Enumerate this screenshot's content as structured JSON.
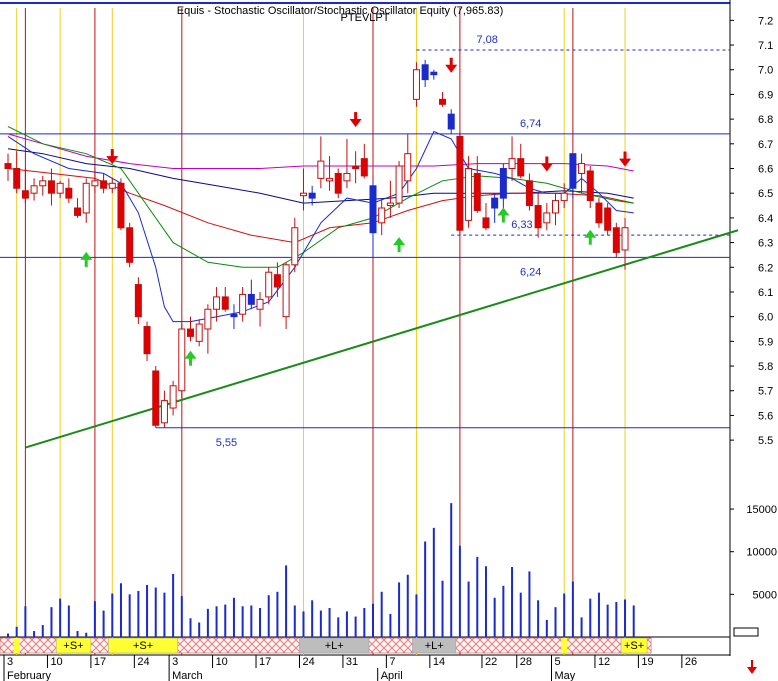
{
  "header": {
    "title": "Equis - Stochastic Oscillator/Stochastic Oscillator Equity (7,965.83)",
    "subtitle": "PTEVLPT"
  },
  "chart_data": {
    "type": "candlestick",
    "price_axis": {
      "ylim": [
        5.46,
        7.25
      ],
      "ticks": [
        7.2,
        7.1,
        7.0,
        6.9,
        6.8,
        6.7,
        6.6,
        6.5,
        6.4,
        6.3,
        6.2,
        6.1,
        6.0,
        5.9,
        5.8,
        5.7,
        5.6,
        5.5
      ],
      "tick_labels": [
        "7.2",
        "7.1",
        "7.0",
        "6.9",
        "6.8",
        "6.7",
        "6.6",
        "6.5",
        "6.4",
        "6.3",
        "6.2",
        "6.1",
        "6.0",
        "5.9",
        "5.8",
        "5.7",
        "5.6",
        "5.5"
      ]
    },
    "volume_axis": {
      "ylim": [
        0,
        17000
      ],
      "ticks": [
        5000,
        10000,
        15000
      ],
      "tick_labels": [
        "5000",
        "10000",
        "15000"
      ]
    },
    "x_axis": {
      "day_labels": [
        "3",
        "10",
        "17",
        "24",
        "3",
        "10",
        "17",
        "24",
        "31",
        "7",
        "14",
        "22",
        "28",
        "5",
        "12",
        "19",
        "26"
      ],
      "day_index": [
        0,
        5,
        10,
        15,
        19,
        24,
        29,
        34,
        39,
        44,
        49,
        55,
        59,
        63,
        68,
        73,
        78
      ],
      "months": [
        {
          "label": "February",
          "index": 0
        },
        {
          "label": "March",
          "index": 19
        },
        {
          "label": "April",
          "index": 43
        },
        {
          "label": "May",
          "index": 63
        }
      ],
      "n_slots": 84
    },
    "candles": [
      {
        "o": 6.62,
        "h": 6.66,
        "l": 6.55,
        "c": 6.6
      },
      {
        "o": 6.6,
        "h": 6.67,
        "l": 6.5,
        "c": 6.52
      },
      {
        "o": 6.51,
        "h": 6.6,
        "l": 6.46,
        "c": 6.48
      },
      {
        "o": 6.5,
        "h": 6.56,
        "l": 6.47,
        "c": 6.53
      },
      {
        "o": 6.53,
        "h": 6.57,
        "l": 6.49,
        "c": 6.55
      },
      {
        "o": 6.55,
        "h": 6.6,
        "l": 6.45,
        "c": 6.5
      },
      {
        "o": 6.5,
        "h": 6.55,
        "l": 6.48,
        "c": 6.54
      },
      {
        "o": 6.52,
        "h": 6.56,
        "l": 6.46,
        "c": 6.48
      },
      {
        "o": 6.44,
        "h": 6.48,
        "l": 6.4,
        "c": 6.41
      },
      {
        "o": 6.42,
        "h": 6.56,
        "l": 6.38,
        "c": 6.54
      },
      {
        "o": 6.53,
        "h": 6.6,
        "l": 6.5,
        "c": 6.55
      },
      {
        "o": 6.55,
        "h": 6.58,
        "l": 6.5,
        "c": 6.52
      },
      {
        "o": 6.52,
        "h": 6.56,
        "l": 6.5,
        "c": 6.54
      },
      {
        "o": 6.54,
        "h": 6.56,
        "l": 6.35,
        "c": 6.36
      },
      {
        "o": 6.36,
        "h": 6.38,
        "l": 6.2,
        "c": 6.22
      },
      {
        "o": 6.13,
        "h": 6.16,
        "l": 5.97,
        "c": 6.0
      },
      {
        "o": 5.96,
        "h": 5.98,
        "l": 5.82,
        "c": 5.85
      },
      {
        "o": 5.78,
        "h": 5.8,
        "l": 5.55,
        "c": 5.56
      },
      {
        "o": 5.57,
        "h": 5.7,
        "l": 5.55,
        "c": 5.66
      },
      {
        "o": 5.63,
        "h": 5.74,
        "l": 5.6,
        "c": 5.72
      },
      {
        "o": 5.7,
        "h": 5.97,
        "l": 5.67,
        "c": 5.95
      },
      {
        "o": 5.95,
        "h": 6.0,
        "l": 5.9,
        "c": 5.92
      },
      {
        "o": 5.9,
        "h": 5.99,
        "l": 5.88,
        "c": 5.97
      },
      {
        "o": 5.95,
        "h": 6.05,
        "l": 5.85,
        "c": 6.03
      },
      {
        "o": 6.03,
        "h": 6.12,
        "l": 5.98,
        "c": 6.08
      },
      {
        "o": 6.08,
        "h": 6.12,
        "l": 6.02,
        "c": 6.03
      },
      {
        "o": 6.0,
        "h": 6.05,
        "l": 5.95,
        "c": 6.01
      },
      {
        "o": 6.01,
        "h": 6.12,
        "l": 5.98,
        "c": 6.09
      },
      {
        "o": 6.09,
        "h": 6.15,
        "l": 6.03,
        "c": 6.05
      },
      {
        "o": 6.03,
        "h": 6.1,
        "l": 5.96,
        "c": 6.07
      },
      {
        "o": 6.08,
        "h": 6.2,
        "l": 6.05,
        "c": 6.18
      },
      {
        "o": 6.17,
        "h": 6.22,
        "l": 6.08,
        "c": 6.12
      },
      {
        "o": 6.0,
        "h": 6.22,
        "l": 5.95,
        "c": 6.21
      },
      {
        "o": 6.21,
        "h": 6.4,
        "l": 6.18,
        "c": 6.36
      },
      {
        "o": 6.49,
        "h": 6.6,
        "l": 6.43,
        "c": 6.5
      },
      {
        "o": 6.5,
        "h": 6.53,
        "l": 6.45,
        "c": 6.48
      },
      {
        "o": 6.56,
        "h": 6.73,
        "l": 6.52,
        "c": 6.63
      },
      {
        "o": 6.55,
        "h": 6.65,
        "l": 6.51,
        "c": 6.56
      },
      {
        "o": 6.58,
        "h": 6.6,
        "l": 6.48,
        "c": 6.5
      },
      {
        "o": 6.55,
        "h": 6.72,
        "l": 6.52,
        "c": 6.58
      },
      {
        "o": 6.61,
        "h": 6.67,
        "l": 6.54,
        "c": 6.6
      },
      {
        "o": 6.64,
        "h": 6.7,
        "l": 6.56,
        "c": 6.57
      },
      {
        "o": 6.53,
        "h": 6.55,
        "l": 6.24,
        "c": 6.34
      },
      {
        "o": 6.38,
        "h": 6.48,
        "l": 6.33,
        "c": 6.44
      },
      {
        "o": 6.45,
        "h": 6.55,
        "l": 6.4,
        "c": 6.46
      },
      {
        "o": 6.46,
        "h": 6.63,
        "l": 6.44,
        "c": 6.61
      },
      {
        "o": 6.55,
        "h": 6.74,
        "l": 6.5,
        "c": 6.66
      },
      {
        "o": 6.88,
        "h": 7.03,
        "l": 6.85,
        "c": 7.0
      },
      {
        "o": 6.96,
        "h": 7.04,
        "l": 6.93,
        "c": 7.02
      },
      {
        "o": 6.99,
        "h": 7.0,
        "l": 6.96,
        "c": 6.98
      },
      {
        "o": 6.88,
        "h": 6.91,
        "l": 6.85,
        "c": 6.86
      },
      {
        "o": 6.82,
        "h": 6.84,
        "l": 6.74,
        "c": 6.76
      },
      {
        "o": 6.73,
        "h": 6.75,
        "l": 6.33,
        "c": 6.35
      },
      {
        "o": 6.39,
        "h": 6.65,
        "l": 6.36,
        "c": 6.6
      },
      {
        "o": 6.58,
        "h": 6.65,
        "l": 6.42,
        "c": 6.43
      },
      {
        "o": 6.4,
        "h": 6.46,
        "l": 6.35,
        "c": 6.36
      },
      {
        "o": 6.44,
        "h": 6.5,
        "l": 6.38,
        "c": 6.48
      },
      {
        "o": 6.48,
        "h": 6.62,
        "l": 6.44,
        "c": 6.6
      },
      {
        "o": 6.6,
        "h": 6.73,
        "l": 6.55,
        "c": 6.64
      },
      {
        "o": 6.64,
        "h": 6.7,
        "l": 6.56,
        "c": 6.57
      },
      {
        "o": 6.55,
        "h": 6.58,
        "l": 6.43,
        "c": 6.45
      },
      {
        "o": 6.45,
        "h": 6.5,
        "l": 6.32,
        "c": 6.36
      },
      {
        "o": 6.38,
        "h": 6.46,
        "l": 6.35,
        "c": 6.42
      },
      {
        "o": 6.42,
        "h": 6.5,
        "l": 6.37,
        "c": 6.47
      },
      {
        "o": 6.47,
        "h": 6.54,
        "l": 6.44,
        "c": 6.5
      },
      {
        "o": 6.52,
        "h": 6.66,
        "l": 6.48,
        "c": 6.66
      },
      {
        "o": 6.58,
        "h": 6.66,
        "l": 6.5,
        "c": 6.62
      },
      {
        "o": 6.59,
        "h": 6.61,
        "l": 6.44,
        "c": 6.47
      },
      {
        "o": 6.46,
        "h": 6.48,
        "l": 6.36,
        "c": 6.38
      },
      {
        "o": 6.44,
        "h": 6.46,
        "l": 6.33,
        "c": 6.35
      },
      {
        "o": 6.36,
        "h": 6.38,
        "l": 6.24,
        "c": 6.26
      },
      {
        "o": 6.27,
        "h": 6.4,
        "l": 6.19,
        "c": 6.36
      }
    ],
    "blue_candles": [
      26,
      28,
      35,
      42,
      48,
      49,
      51,
      56,
      57,
      65
    ],
    "volume": [
      400,
      1200,
      3600,
      700,
      1400,
      3500,
      4500,
      3700,
      700,
      500,
      4200,
      3100,
      5100,
      6300,
      5000,
      5400,
      6100,
      5800,
      5200,
      7400,
      4800,
      2200,
      1700,
      3300,
      3600,
      3800,
      4600,
      3600,
      3700,
      3400,
      4900,
      5300,
      8400,
      3700,
      3000,
      4300,
      3100,
      3400,
      2300,
      3000,
      2400,
      3400,
      3900,
      5300,
      2700,
      6400,
      7300,
      5000,
      11200,
      12800,
      6600,
      15700,
      10700,
      6500,
      9400,
      8300,
      4600,
      6000,
      8200,
      5200,
      7700,
      4300,
      2000,
      3500,
      5100,
      6500,
      2300,
      4500,
      5200,
      3800,
      4100,
      4400,
      3700
    ],
    "horizontal_levels": [
      {
        "value": 7.08,
        "label": "7,08",
        "style": "dashed",
        "start": 47
      },
      {
        "value": 6.74,
        "label": "6,74",
        "style": "solid",
        "start": 0
      },
      {
        "value": 6.33,
        "label": "6,33",
        "style": "dashed",
        "start": 51
      },
      {
        "value": 6.24,
        "label": "6,24",
        "style": "solid",
        "start": 0
      },
      {
        "value": 5.55,
        "label": "5,55",
        "style": "solid",
        "start": 17
      }
    ],
    "trendline": {
      "x1": 2,
      "y1": 5.47,
      "x2": 84,
      "y2": 6.35
    },
    "ma_series": [
      {
        "color": "#c000c0",
        "points": [
          [
            0,
            6.74
          ],
          [
            4,
            6.7
          ],
          [
            9,
            6.65
          ],
          [
            14,
            6.62
          ],
          [
            19,
            6.6
          ],
          [
            24,
            6.6
          ],
          [
            29,
            6.6
          ],
          [
            34,
            6.61
          ],
          [
            39,
            6.61
          ],
          [
            44,
            6.61
          ],
          [
            49,
            6.61
          ],
          [
            54,
            6.62
          ],
          [
            59,
            6.62
          ],
          [
            64,
            6.62
          ],
          [
            69,
            6.61
          ],
          [
            72,
            6.59
          ]
        ]
      },
      {
        "color": "#0a0a80",
        "points": [
          [
            0,
            6.68
          ],
          [
            4,
            6.66
          ],
          [
            9,
            6.62
          ],
          [
            14,
            6.6
          ],
          [
            19,
            6.56
          ],
          [
            24,
            6.53
          ],
          [
            29,
            6.5
          ],
          [
            34,
            6.46
          ],
          [
            39,
            6.47
          ],
          [
            44,
            6.48
          ],
          [
            49,
            6.5
          ],
          [
            54,
            6.5
          ],
          [
            59,
            6.5
          ],
          [
            64,
            6.51
          ],
          [
            69,
            6.5
          ],
          [
            72,
            6.48
          ]
        ]
      },
      {
        "color": "#d01010",
        "points": [
          [
            0,
            6.6
          ],
          [
            5,
            6.58
          ],
          [
            10,
            6.56
          ],
          [
            14,
            6.5
          ],
          [
            18,
            6.45
          ],
          [
            23,
            6.38
          ],
          [
            28,
            6.33
          ],
          [
            33,
            6.3
          ],
          [
            37,
            6.36
          ],
          [
            42,
            6.38
          ],
          [
            46,
            6.43
          ],
          [
            50,
            6.47
          ],
          [
            54,
            6.49
          ],
          [
            58,
            6.5
          ],
          [
            63,
            6.5
          ],
          [
            68,
            6.49
          ],
          [
            72,
            6.46
          ]
        ]
      },
      {
        "color": "#0a8a0a",
        "points": [
          [
            0,
            6.77
          ],
          [
            4,
            6.7
          ],
          [
            9,
            6.66
          ],
          [
            13,
            6.6
          ],
          [
            16,
            6.45
          ],
          [
            19,
            6.3
          ],
          [
            23,
            6.22
          ],
          [
            27,
            6.2
          ],
          [
            31,
            6.2
          ],
          [
            34,
            6.26
          ],
          [
            38,
            6.36
          ],
          [
            42,
            6.4
          ],
          [
            46,
            6.48
          ],
          [
            50,
            6.55
          ],
          [
            54,
            6.57
          ],
          [
            58,
            6.56
          ],
          [
            62,
            6.54
          ],
          [
            66,
            6.5
          ],
          [
            70,
            6.47
          ],
          [
            72,
            6.46
          ]
        ]
      },
      {
        "color": "#1a2acc",
        "points": [
          [
            0,
            6.73
          ],
          [
            3,
            6.66
          ],
          [
            7,
            6.6
          ],
          [
            11,
            6.58
          ],
          [
            13,
            6.54
          ],
          [
            15,
            6.42
          ],
          [
            17,
            6.2
          ],
          [
            18,
            6.04
          ],
          [
            19,
            5.98
          ],
          [
            21,
            5.98
          ],
          [
            24,
            6.0
          ],
          [
            27,
            6.02
          ],
          [
            30,
            6.06
          ],
          [
            33,
            6.2
          ],
          [
            36,
            6.38
          ],
          [
            39,
            6.48
          ],
          [
            42,
            6.46
          ],
          [
            45,
            6.5
          ],
          [
            47,
            6.6
          ],
          [
            49,
            6.75
          ],
          [
            51,
            6.72
          ],
          [
            53,
            6.6
          ],
          [
            56,
            6.58
          ],
          [
            58,
            6.56
          ],
          [
            60,
            6.52
          ],
          [
            62,
            6.5
          ],
          [
            64,
            6.5
          ],
          [
            66,
            6.56
          ],
          [
            68,
            6.5
          ],
          [
            70,
            6.43
          ],
          [
            72,
            6.42
          ]
        ]
      }
    ],
    "signals": [
      {
        "slot": 12,
        "dir": "down",
        "value": 6.63
      },
      {
        "slot": 9,
        "dir": "up",
        "value": 6.25
      },
      {
        "slot": 21,
        "dir": "up",
        "value": 5.85
      },
      {
        "slot": 40,
        "dir": "down",
        "value": 6.78
      },
      {
        "slot": 45,
        "dir": "up",
        "value": 6.31
      },
      {
        "slot": 51,
        "dir": "down",
        "value": 7.0
      },
      {
        "slot": 57,
        "dir": "up",
        "value": 6.43
      },
      {
        "slot": 62,
        "dir": "down",
        "value": 6.6
      },
      {
        "slot": 67,
        "dir": "up",
        "value": 6.34
      },
      {
        "slot": 71,
        "dir": "down",
        "value": 6.62
      }
    ],
    "vertical_lines": {
      "red": [
        2,
        10,
        20,
        42,
        52,
        65
      ],
      "yellow": [
        1,
        6,
        12,
        34,
        47,
        64,
        71
      ]
    },
    "signal_bar": {
      "labels": [
        {
          "text": "+S+",
          "start": 6,
          "end": 10,
          "color": "#ffff33"
        },
        {
          "text": "+S+",
          "start": 12,
          "end": 20,
          "color": "#ffff33"
        },
        {
          "text": "+L+",
          "start": 34,
          "end": 42,
          "color": "#bdbdbd"
        },
        {
          "text": "+L+",
          "start": 47,
          "end": 52,
          "color": "#bdbdbd"
        },
        {
          "text": "+S+",
          "start": 71,
          "end": 74,
          "color": "#ffff33"
        }
      ],
      "yellow_marks": [
        1,
        64
      ]
    }
  },
  "footer": {
    "arrow": "down-arrow-icon"
  }
}
